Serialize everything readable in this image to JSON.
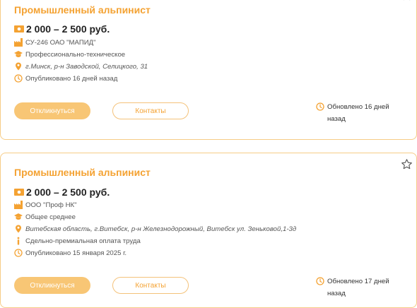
{
  "vacancies": [
    {
      "title": "Промышленный альпинист",
      "salary": "2 000 – 2 500 руб.",
      "company": "СУ-246 ОАО \"МАПИД\"",
      "education": "Профессионально-техническое",
      "address": "г.Минск, р-н Заводской, Селицкого, 31",
      "published": "Опубликовано 16 дней назад",
      "apply_label": "Откликнуться",
      "contacts_label": "Контакты",
      "updated": "Обновлено 16 дней назад"
    },
    {
      "title": "Промышленный альпинист",
      "salary": "2 000 – 2 500 руб.",
      "company": "ООО \"Проф НК\"",
      "education": "Общее среднее",
      "address": "Витебская область, г.Витебск, р-н Железнодорожный, Витебск ул. Зеньковой,1-3д",
      "pay_type": "Сдельно-премиальная оплата труда",
      "published": "Опубликовано 15 января 2025 г.",
      "apply_label": "Откликнуться",
      "contacts_label": "Контакты",
      "updated": "Обновлено 17 дней назад"
    }
  ],
  "colors": {
    "accent": "#f4a232",
    "button_fill": "#f8c675",
    "border": "#f6cc86"
  },
  "icons": [
    "star-icon",
    "money-icon",
    "factory-icon",
    "graduation-cap-icon",
    "location-pin-icon",
    "clock-icon",
    "info-icon"
  ]
}
